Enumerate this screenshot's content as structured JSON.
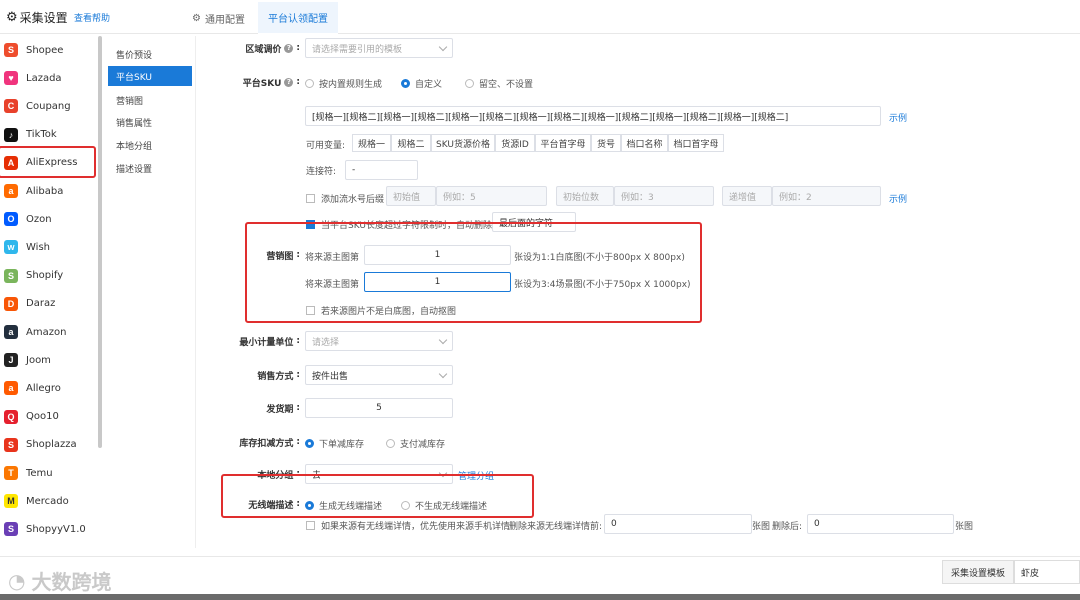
{
  "header": {
    "title": "采集设置",
    "help": "查看帮助",
    "tabs": [
      "通用配置",
      "平台认领配置"
    ]
  },
  "platforms": [
    {
      "name": "Shopee",
      "icon": "shopee-icon",
      "color": "#ee4d2d",
      "glyph": "S"
    },
    {
      "name": "Lazada",
      "icon": "lazada-icon",
      "color": "#f0347d",
      "glyph": "♥"
    },
    {
      "name": "Coupang",
      "icon": "coupang-icon",
      "color": "#e8412b",
      "glyph": "C"
    },
    {
      "name": "TikTok",
      "icon": "tiktok-icon",
      "color": "#111111",
      "glyph": "♪"
    },
    {
      "name": "AliExpress",
      "icon": "aliexpress-icon",
      "color": "#e62e04",
      "glyph": "A"
    },
    {
      "name": "Alibaba",
      "icon": "alibaba-icon",
      "color": "#ff6a00",
      "glyph": "a"
    },
    {
      "name": "Ozon",
      "icon": "ozon-icon",
      "color": "#005bff",
      "glyph": "O"
    },
    {
      "name": "Wish",
      "icon": "wish-icon",
      "color": "#2fb7ec",
      "glyph": "w"
    },
    {
      "name": "Shopify",
      "icon": "shopify-icon",
      "color": "#7ab55c",
      "glyph": "S"
    },
    {
      "name": "Daraz",
      "icon": "daraz-icon",
      "color": "#f85606",
      "glyph": "D"
    },
    {
      "name": "Amazon",
      "icon": "amazon-icon",
      "color": "#232f3e",
      "glyph": "a"
    },
    {
      "name": "Joom",
      "icon": "joom-icon",
      "color": "#222222",
      "glyph": "J"
    },
    {
      "name": "Allegro",
      "icon": "allegro-icon",
      "color": "#ff5a00",
      "glyph": "a"
    },
    {
      "name": "Qoo10",
      "icon": "qoo10-icon",
      "color": "#e5202e",
      "glyph": "Q"
    },
    {
      "name": "Shoplazza",
      "icon": "shoplazza-icon",
      "color": "#e8341c",
      "glyph": "S"
    },
    {
      "name": "Temu",
      "icon": "temu-icon",
      "color": "#fb7701",
      "glyph": "T"
    },
    {
      "name": "Mercado",
      "icon": "mercado-icon",
      "color": "#ffe600",
      "glyph": "M"
    },
    {
      "name": "ShopyyV1.0",
      "icon": "shopyy-icon",
      "color": "#6a3fb5",
      "glyph": "S"
    }
  ],
  "config_menu": [
    "售价预设",
    "平台SKU",
    "营销图",
    "销售属性",
    "本地分组",
    "描述设置"
  ],
  "form": {
    "region": {
      "label": "区域调价",
      "placeholder": "请选择需要引用的模板"
    },
    "sku": {
      "label": "平台SKU",
      "options": [
        "按内置规则生成",
        "自定义",
        "留空、不设置"
      ],
      "pattern": "[规格一][规格二][规格一][规格二][规格一][规格二][规格一][规格二][规格一][规格二][规格一][规格二][规格一][规格二]",
      "example": "示例",
      "vars_label": "可用变量:",
      "vars": [
        "规格一",
        "规格二",
        "SKU货源价格",
        "货源ID",
        "平台首字母",
        "货号",
        "档口名称",
        "档口首字母"
      ],
      "connector_label": "连接符:",
      "connector_value": "-",
      "serial_label": "添加流水号后缀",
      "serial_start": "初始值",
      "serial_start_ex": "例如：5",
      "serial_digits": "初始位数",
      "serial_digits_ex": "例如：3",
      "serial_step": "递增值",
      "serial_step_ex": "例如：2",
      "serial_example": "示例",
      "truncate_label": "当平台SKU长度超过字符限制时，自动删除",
      "truncate_value": "最后面的字符"
    },
    "marketing": {
      "label": "营销图",
      "row1_prefix": "将来源主图第",
      "row1_value": "1",
      "row1_suffix": "张设为1:1白底图(不小于800px X 800px)",
      "row2_prefix": "将来源主图第",
      "row2_value": "1",
      "row2_suffix": "张设为3:4场景图(不小于750px X 1000px)",
      "auto_cutout": "若来源图片不是白底图，自动抠图"
    },
    "min_unit": {
      "label": "最小计量单位",
      "placeholder": "请选择"
    },
    "sale_method": {
      "label": "销售方式",
      "value": "按件出售"
    },
    "ship_period": {
      "label": "发货期",
      "value": "5"
    },
    "stock_deduct": {
      "label": "库存扣减方式",
      "options": [
        "下单减库存",
        "支付减库存"
      ]
    },
    "local_group": {
      "label": "本地分组",
      "value": "去",
      "manage": "管理分组"
    },
    "wireless": {
      "label": "无线端描述",
      "options": [
        "生成无线端描述",
        "不生成无线端描述"
      ],
      "detail_note": "如果来源有无线端详情，优先使用来源手机详情",
      "delete_before": "删除来源无线端详情前:",
      "delete_before_value": "0",
      "unit_before": "张图",
      "delete_after": "删除后:",
      "delete_after_value": "0",
      "unit_after": "张图"
    }
  },
  "footer": {
    "watermark": "大数跨境",
    "template_label": "采集设置模板",
    "template_value": "虾皮"
  }
}
